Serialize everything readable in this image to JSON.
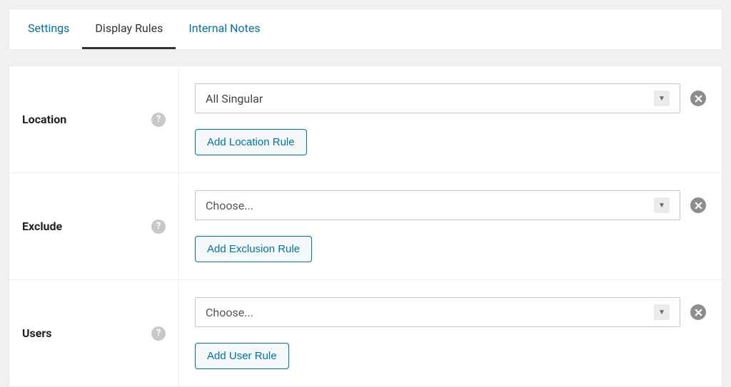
{
  "tabs": {
    "settings": "Settings",
    "display_rules": "Display Rules",
    "internal_notes": "Internal Notes",
    "active": "display_rules"
  },
  "rows": {
    "location": {
      "label": "Location",
      "select_value": "All Singular",
      "is_placeholder": false,
      "add_button": "Add Location Rule"
    },
    "exclude": {
      "label": "Exclude",
      "select_value": "Choose...",
      "is_placeholder": true,
      "add_button": "Add Exclusion Rule"
    },
    "users": {
      "label": "Users",
      "select_value": "Choose...",
      "is_placeholder": true,
      "add_button": "Add User Rule"
    }
  },
  "icons": {
    "help": "?",
    "chevron_down": "▼"
  }
}
